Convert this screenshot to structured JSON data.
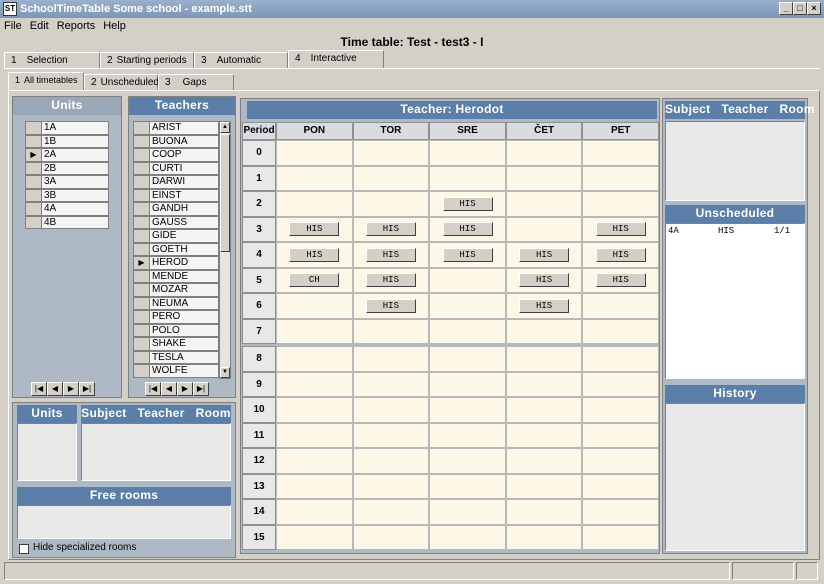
{
  "window": {
    "title": "SchoolTimeTable Some school - example.stt",
    "icon_text": "ST"
  },
  "menu": [
    "File",
    "Edit",
    "Reports",
    "Help"
  ],
  "timetable_title": "Time table:  Test - test3 - I",
  "main_tabs": [
    {
      "num": "1",
      "label": "Selection"
    },
    {
      "num": "2",
      "label": "Starting periods"
    },
    {
      "num": "3",
      "label": "Automatic"
    },
    {
      "num": "4",
      "label": "Interactive"
    }
  ],
  "sub_tabs": [
    {
      "num": "1",
      "label": "All timetables"
    },
    {
      "num": "2",
      "label": "Unscheduled"
    },
    {
      "num": "3",
      "label": "Gaps"
    }
  ],
  "units": {
    "title": "Units",
    "items": [
      "1A",
      "1B",
      "2A",
      "2B",
      "3A",
      "3B",
      "4A",
      "4B"
    ],
    "selected": "2A"
  },
  "teachers": {
    "title": "Teachers",
    "items": [
      "ARIST",
      "BUONA",
      "COOP",
      "CURTI",
      "DARWI",
      "EINST",
      "GANDH",
      "GAUSS",
      "GIDE",
      "GOETH",
      "HEROD",
      "MENDE",
      "MOZAR",
      "NEUMA",
      "PERO",
      "POLO",
      "SHAKE",
      "TESLA",
      "WOLFE"
    ],
    "selected": "HEROD"
  },
  "nav_glyphs": [
    "|◀",
    "◀",
    "▶",
    "▶|"
  ],
  "bottom_left": {
    "units_title": "Units",
    "detail_title": "Subject   Teacher   Room",
    "free_rooms_title": "Free rooms",
    "hide_specialized_label": "Hide specialized rooms"
  },
  "grid": {
    "title": "Teacher: Herodot",
    "period_label": "Period",
    "days": [
      "PON",
      "TOR",
      "SRE",
      "ČET",
      "PET"
    ],
    "periods": [
      "0",
      "1",
      "2",
      "3",
      "4",
      "5",
      "6",
      "7",
      "8",
      "9",
      "10",
      "11",
      "12",
      "13",
      "14",
      "15"
    ],
    "lessons": [
      {
        "period": 2,
        "day": 2,
        "label": "HIS"
      },
      {
        "period": 3,
        "day": 0,
        "label": "HIS"
      },
      {
        "period": 3,
        "day": 1,
        "label": "HIS"
      },
      {
        "period": 3,
        "day": 2,
        "label": "HIS"
      },
      {
        "period": 3,
        "day": 4,
        "label": "HIS"
      },
      {
        "period": 4,
        "day": 0,
        "label": "HIS"
      },
      {
        "period": 4,
        "day": 1,
        "label": "HIS"
      },
      {
        "period": 4,
        "day": 2,
        "label": "HIS"
      },
      {
        "period": 4,
        "day": 3,
        "label": "HIS"
      },
      {
        "period": 4,
        "day": 4,
        "label": "HIS"
      },
      {
        "period": 5,
        "day": 0,
        "label": "CH"
      },
      {
        "period": 5,
        "day": 1,
        "label": "HIS"
      },
      {
        "period": 5,
        "day": 3,
        "label": "HIS"
      },
      {
        "period": 5,
        "day": 4,
        "label": "HIS"
      },
      {
        "period": 6,
        "day": 1,
        "label": "HIS"
      },
      {
        "period": 6,
        "day": 3,
        "label": "HIS"
      }
    ]
  },
  "right": {
    "detail_title": "Subject   Teacher   Room",
    "unscheduled_title": "Unscheduled",
    "unscheduled_row": {
      "unit": "4A",
      "subject": "HIS",
      "count": "1/1"
    },
    "history_title": "History"
  }
}
